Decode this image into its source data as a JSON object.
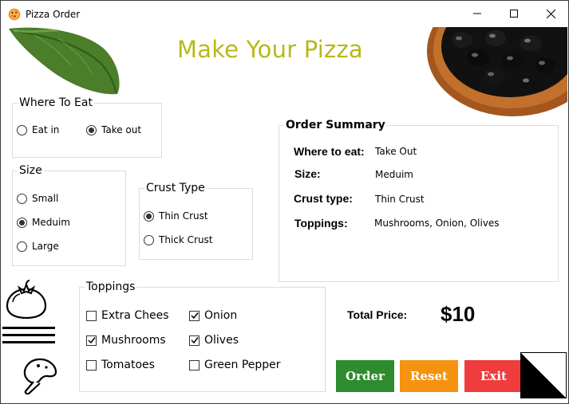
{
  "window": {
    "title": "Pizza Order"
  },
  "header": {
    "heading": "Make Your Pizza"
  },
  "where_to_eat": {
    "legend": "Where To Eat",
    "options": [
      {
        "label": "Eat in",
        "selected": false
      },
      {
        "label": "Take out",
        "selected": true
      }
    ]
  },
  "size": {
    "legend": "Size",
    "options": [
      {
        "label": "Small",
        "selected": false
      },
      {
        "label": "Meduim",
        "selected": true
      },
      {
        "label": "Large",
        "selected": false
      }
    ]
  },
  "crust": {
    "legend": "Crust Type",
    "options": [
      {
        "label": "Thin Crust",
        "selected": true
      },
      {
        "label": "Thick Crust",
        "selected": false
      }
    ]
  },
  "toppings": {
    "legend": "Toppings",
    "options": [
      {
        "label": "Extra Chees",
        "checked": false
      },
      {
        "label": "Onion",
        "checked": true
      },
      {
        "label": "Mushrooms",
        "checked": true
      },
      {
        "label": "Olives",
        "checked": true
      },
      {
        "label": "Tomatoes",
        "checked": false
      },
      {
        "label": "Green Pepper",
        "checked": false
      }
    ]
  },
  "summary": {
    "title": "Order Summary",
    "rows": [
      {
        "label": "Where to eat:",
        "value": "Take Out"
      },
      {
        "label": "Size:",
        "value": "Meduim"
      },
      {
        "label": "Crust type:",
        "value": "Thin Crust"
      },
      {
        "label": "Toppings:",
        "value": "Mushrooms, Onion, Olives"
      }
    ]
  },
  "total": {
    "label": "Total Price:",
    "value": "$10"
  },
  "buttons": {
    "order": "Order",
    "reset": "Reset",
    "exit": "Exit"
  },
  "colors": {
    "heading": "#b8b81a",
    "order_button": "#2e8b2e",
    "reset_button": "#f5920f",
    "exit_button": "#ef3c3c"
  },
  "icons": [
    "pizza-app-icon",
    "minimize-icon",
    "maximize-icon",
    "close-icon",
    "tomato-icon",
    "hamburger-menu-icon",
    "mushroom-icon",
    "split-square-icon"
  ]
}
